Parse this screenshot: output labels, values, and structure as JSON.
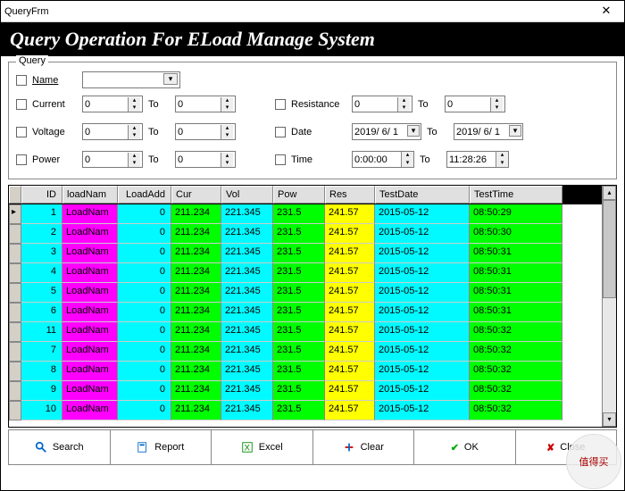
{
  "window": {
    "title": "QueryFrm"
  },
  "banner": "Query Operation For ELoad Manage System",
  "query": {
    "legend": "Query",
    "name_label": "Name",
    "current_label": "Current",
    "current_from": "0",
    "current_to": "0",
    "voltage_label": "Voltage",
    "voltage_from": "0",
    "voltage_to": "0",
    "power_label": "Power",
    "power_from": "0",
    "power_to": "0",
    "resistance_label": "Resistance",
    "resistance_from": "0",
    "resistance_to": "0",
    "date_label": "Date",
    "date_from": "2019/ 6/ 1",
    "date_to": "2019/ 6/ 1",
    "time_label": "Time",
    "time_from": "0:00:00",
    "time_to": "11:28:26",
    "to_label": "To"
  },
  "grid": {
    "headers": {
      "id": "ID",
      "name": "loadNam",
      "add": "LoadAdd",
      "cur": "Cur",
      "vol": "Vol",
      "pow": "Pow",
      "res": "Res",
      "date": "TestDate",
      "time": "TestTime"
    },
    "rows": [
      {
        "id": "1",
        "name": "LoadNam",
        "add": "0",
        "cur": "211.234",
        "vol": "221.345",
        "pow": "231.5",
        "res": "241.57",
        "date": "2015-05-12",
        "time": "08:50:29"
      },
      {
        "id": "2",
        "name": "LoadNam",
        "add": "0",
        "cur": "211.234",
        "vol": "221.345",
        "pow": "231.5",
        "res": "241.57",
        "date": "2015-05-12",
        "time": "08:50:30"
      },
      {
        "id": "3",
        "name": "LoadNam",
        "add": "0",
        "cur": "211.234",
        "vol": "221.345",
        "pow": "231.5",
        "res": "241.57",
        "date": "2015-05-12",
        "time": "08:50:31"
      },
      {
        "id": "4",
        "name": "LoadNam",
        "add": "0",
        "cur": "211.234",
        "vol": "221.345",
        "pow": "231.5",
        "res": "241.57",
        "date": "2015-05-12",
        "time": "08:50:31"
      },
      {
        "id": "5",
        "name": "LoadNam",
        "add": "0",
        "cur": "211.234",
        "vol": "221.345",
        "pow": "231.5",
        "res": "241.57",
        "date": "2015-05-12",
        "time": "08:50:31"
      },
      {
        "id": "6",
        "name": "LoadNam",
        "add": "0",
        "cur": "211.234",
        "vol": "221.345",
        "pow": "231.5",
        "res": "241.57",
        "date": "2015-05-12",
        "time": "08:50:31"
      },
      {
        "id": "11",
        "name": "LoadNam",
        "add": "0",
        "cur": "211.234",
        "vol": "221.345",
        "pow": "231.5",
        "res": "241.57",
        "date": "2015-05-12",
        "time": "08:50:32"
      },
      {
        "id": "7",
        "name": "LoadNam",
        "add": "0",
        "cur": "211.234",
        "vol": "221.345",
        "pow": "231.5",
        "res": "241.57",
        "date": "2015-05-12",
        "time": "08:50:32"
      },
      {
        "id": "8",
        "name": "LoadNam",
        "add": "0",
        "cur": "211.234",
        "vol": "221.345",
        "pow": "231.5",
        "res": "241.57",
        "date": "2015-05-12",
        "time": "08:50:32"
      },
      {
        "id": "9",
        "name": "LoadNam",
        "add": "0",
        "cur": "211.234",
        "vol": "221.345",
        "pow": "231.5",
        "res": "241.57",
        "date": "2015-05-12",
        "time": "08:50:32"
      },
      {
        "id": "10",
        "name": "LoadNam",
        "add": "0",
        "cur": "211.234",
        "vol": "221.345",
        "pow": "231.5",
        "res": "241.57",
        "date": "2015-05-12",
        "time": "08:50:32"
      }
    ]
  },
  "buttons": {
    "search": "Search",
    "report": "Report",
    "excel": "Excel",
    "clear": "Clear",
    "ok": "OK",
    "close": "Close"
  },
  "watermark": "值得买"
}
